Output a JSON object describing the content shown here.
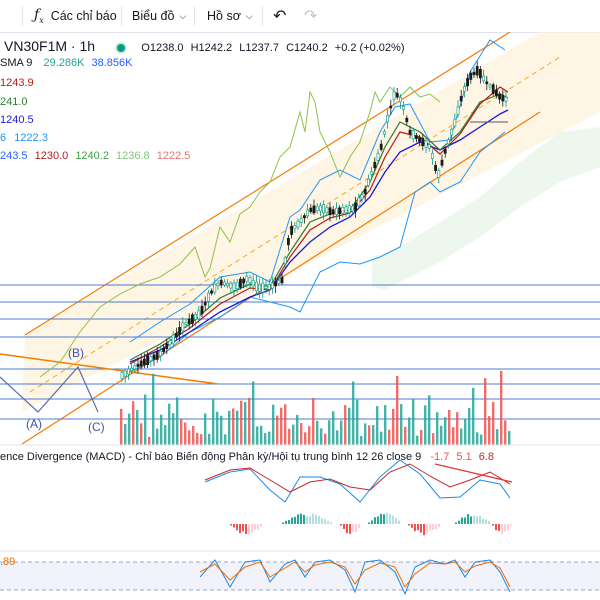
{
  "toolbar": {
    "tf": "1h",
    "indicators_label": "Các chỉ báo",
    "chart_label": "Biểu đồ",
    "profile_label": "Hồ sơ",
    "undo_icon": "undo-icon",
    "redo_icon": "redo-icon",
    "fx_icon": "fx-icon"
  },
  "legend": {
    "symbol": "VN30F1M · 1h",
    "open_label": "O",
    "open": "1238.0",
    "high_label": "H",
    "high": "1242.2",
    "low_label": "L",
    "low": "1237.7",
    "close_label": "C",
    "close": "1240.2",
    "change": "+0.2 (+0.02%)",
    "vol_name": "SMA 9",
    "vol_1": "29.286K",
    "vol_2": "38.856K",
    "ma_1": "1243.9",
    "ma_2": "241.0",
    "ma_3": "1240.5",
    "bb_prefix": "6",
    "bb_value": "1222.3",
    "ichimoku": [
      "243.5",
      "1230.0",
      "1240.2",
      "1236.8",
      "1222.5"
    ],
    "macd_title": "ence Divergence (MACD) - Chỉ báo Biến động Phân kỳ/Hội tụ trung bình 12 26 close 9",
    "macd_values": [
      "-1.7",
      "5.1",
      "6.8"
    ],
    "stoch_value": ".89"
  },
  "annotations": [
    "(A)",
    "(B)",
    "(C)"
  ],
  "colors": {
    "up": "#089981",
    "down": "#f23645",
    "channel": "#f57c00",
    "fib": "#4a7bd4",
    "ma_red": "#b71c1c",
    "ma_green": "#2e7d32",
    "ma_blue": "#1a1ad6",
    "bb": "#2196f3",
    "lagging": "#8bc34a",
    "macd_line": "#1e88e5",
    "signal_line": "#c62828",
    "vol_up": "#26a69a",
    "vol_down": "#ef5350"
  }
}
